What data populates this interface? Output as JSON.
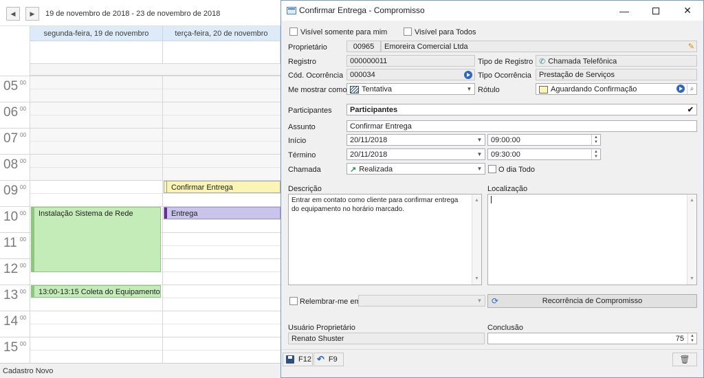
{
  "calendar": {
    "range": "19 de novembro de 2018 - 23 de novembro de 2018",
    "days": [
      "segunda-feira, 19 de novembro",
      "terça-feira, 20 de novembro"
    ],
    "hours": [
      "05",
      "06",
      "07",
      "08",
      "09",
      "10",
      "11",
      "12",
      "13",
      "14",
      "15"
    ],
    "minute_label": "00",
    "appointments": {
      "instalacao": "Instalação Sistema de Rede",
      "coleta": "13:00-13:15 Coleta do Equipamento",
      "confirmar": "Confirmar Entrega",
      "entrega": "Entrega"
    },
    "status": "Cadastro Novo"
  },
  "dialog": {
    "title": "Confirmar Entrega - Compromisso",
    "visible_me": "Visível somente para mim",
    "visible_all": "Visível para Todos",
    "proprietario_label": "Proprietário",
    "proprietario_code": "00965",
    "proprietario_name": "Emoreira Comercial Ltda",
    "registro_label": "Registro",
    "registro_value": "000000011",
    "tipo_registro_label": "Tipo de Registro",
    "tipo_registro_value": "Chamada Telefônica",
    "cod_ocorrencia_label": "Cód. Ocorrência",
    "cod_ocorrencia_value": "000034",
    "tipo_ocorrencia_label": "Tipo Ocorrência",
    "tipo_ocorrencia_value": "Prestação de Serviços",
    "mostrar_label": "Me mostrar como",
    "mostrar_value": "Tentativa",
    "rotulo_label": "Rótulo",
    "rotulo_value": "Aguardando Confirmação",
    "participantes_label": "Participantes",
    "participantes_value": "Participantes",
    "assunto_label": "Assunto",
    "assunto_value": "Confirmar Entrega",
    "inicio_label": "Início",
    "inicio_date": "20/11/2018",
    "inicio_time": "09:00:00",
    "termino_label": "Término",
    "termino_date": "20/11/2018",
    "termino_time": "09:30:00",
    "chamada_label": "Chamada",
    "chamada_value": "Realizada",
    "dia_todo": "O dia Todo",
    "descricao_label": "Descrição",
    "descricao_value": "Entrar em contato como cliente para confirmar entrega do equipamento no horário marcado.",
    "localizacao_label": "Localização",
    "relembrar_label": "Relembrar-me em:",
    "recorrencia_label": "Recorrência de Compromisso",
    "usuario_label": "Usuário Proprietário",
    "usuario_value": "Renato Shuster",
    "conclusao_label": "Conclusão",
    "conclusao_value": "75",
    "save_key": "F12",
    "undo_key": "F9"
  },
  "colors": {
    "accent": "#2f66c4",
    "header_bg": "#dcebf7",
    "green_appt": "#c4ecb8",
    "yellow_appt": "#fbf5b5",
    "purple_appt": "#c9c4ec"
  }
}
